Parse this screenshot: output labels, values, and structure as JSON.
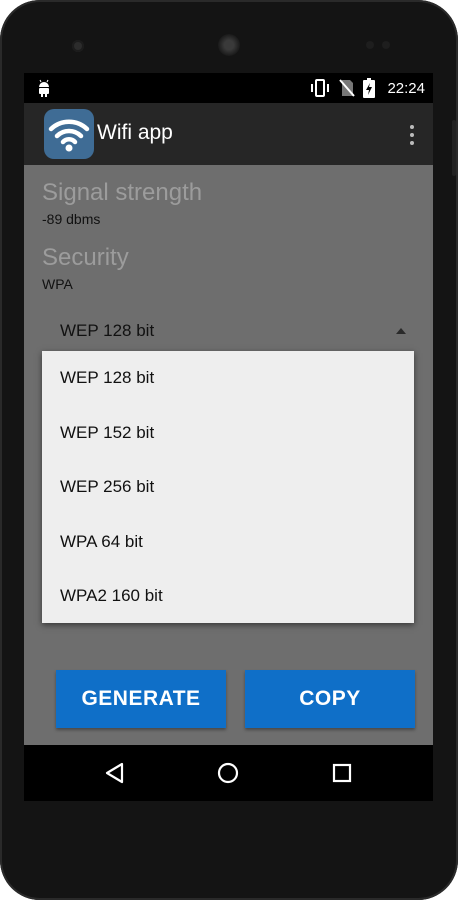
{
  "statusbar": {
    "time": "22:24",
    "icons": [
      "android-icon",
      "vibrate-icon",
      "no-sim-icon",
      "battery-charging-icon"
    ]
  },
  "appbar": {
    "title": "Wifi app",
    "icon": "wifi-icon",
    "overflow_icon": "overflow-menu-icon"
  },
  "signal": {
    "label": "Signal strength",
    "value": "-89 dbms"
  },
  "security": {
    "label": "Security",
    "value": "WPA"
  },
  "spinner": {
    "selected": "WEP 128 bit"
  },
  "dropdown": {
    "options": [
      "WEP 128 bit",
      "WEP 152 bit",
      "WEP 256 bit",
      "WPA 64 bit",
      "WPA2 160 bit"
    ]
  },
  "buttons": {
    "generate": "GENERATE",
    "copy": "COPY"
  },
  "navbar": {
    "icons": [
      "back-icon",
      "home-icon",
      "recents-icon"
    ]
  },
  "colors": {
    "accent": "#0f6fc8",
    "appbar": "#262626",
    "app_icon_bg": "#3f6c95"
  }
}
